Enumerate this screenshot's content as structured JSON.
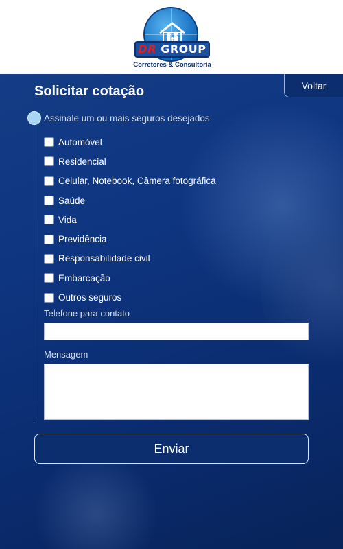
{
  "header": {
    "logo": {
      "name_part1": "DR",
      "name_part2": "GROUP",
      "tagline": "Corretores & Consultoria"
    },
    "colors": {
      "brand_blue": "#1b4fa0",
      "brand_red": "#e02020"
    }
  },
  "nav": {
    "back_label": "Voltar"
  },
  "form": {
    "title": "Solicitar cotação",
    "insurance_prompt": "Assinale um ou mais seguros desejados",
    "options": [
      {
        "label": "Automóvel",
        "checked": false
      },
      {
        "label": "Residencial",
        "checked": false
      },
      {
        "label": "Celular, Notebook, Câmera fotográfica",
        "checked": false
      },
      {
        "label": "Saúde",
        "checked": false
      },
      {
        "label": "Vida",
        "checked": false
      },
      {
        "label": "Previdência",
        "checked": false
      },
      {
        "label": "Responsabilidade civil",
        "checked": false
      },
      {
        "label": "Embarcação",
        "checked": false
      },
      {
        "label": "Outros seguros",
        "checked": false
      }
    ],
    "phone": {
      "label": "Telefone para contato",
      "value": ""
    },
    "message": {
      "label": "Mensagem",
      "value": ""
    },
    "submit_label": "Enviar"
  },
  "theme": {
    "background": "#0e3580",
    "panel": "#0d2e6e",
    "accent_dot": "#a8d4f5"
  }
}
